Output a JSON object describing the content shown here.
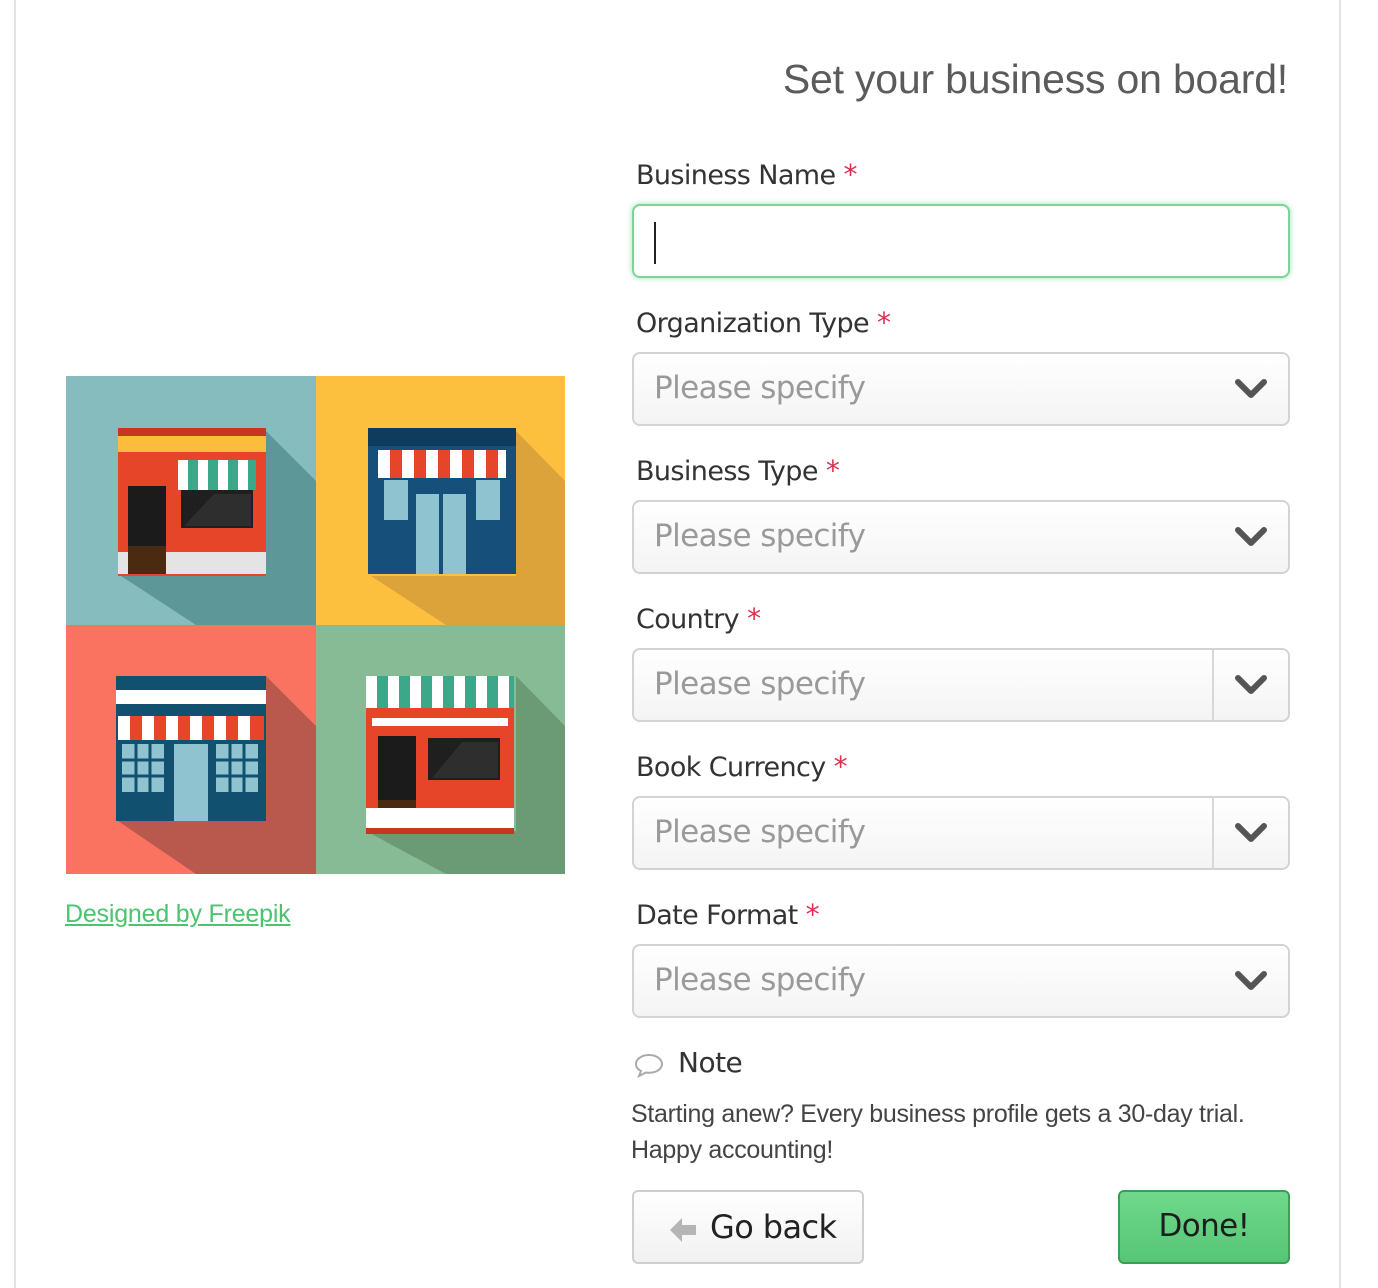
{
  "form": {
    "title": "Set your business on board!",
    "business_name": {
      "label": "Business Name",
      "required_mark": "*",
      "value": ""
    },
    "organization_type": {
      "label": "Organization Type",
      "required_mark": "*",
      "value": "Please specify"
    },
    "business_type": {
      "label": "Business Type",
      "required_mark": "*",
      "value": "Please specify"
    },
    "country": {
      "label": "Country",
      "required_mark": "*",
      "value": "Please specify"
    },
    "book_currency": {
      "label": "Book Currency",
      "required_mark": "*",
      "value": "Please specify"
    },
    "date_format": {
      "label": "Date Format",
      "required_mark": "*",
      "value": "Please specify"
    }
  },
  "note": {
    "label": "Note",
    "text_line1": "Starting anew? Every business profile gets a 30-day trial.",
    "text_line2": "Happy accounting!"
  },
  "buttons": {
    "go_back": "Go back",
    "done": "Done!"
  },
  "illustration": {
    "credit": "Designed by Freepik",
    "icon": "storefronts-illustration"
  },
  "colors": {
    "accent_green": "#5ccb7b",
    "required_red": "#d9304f",
    "focus_border": "#7fd39a"
  }
}
